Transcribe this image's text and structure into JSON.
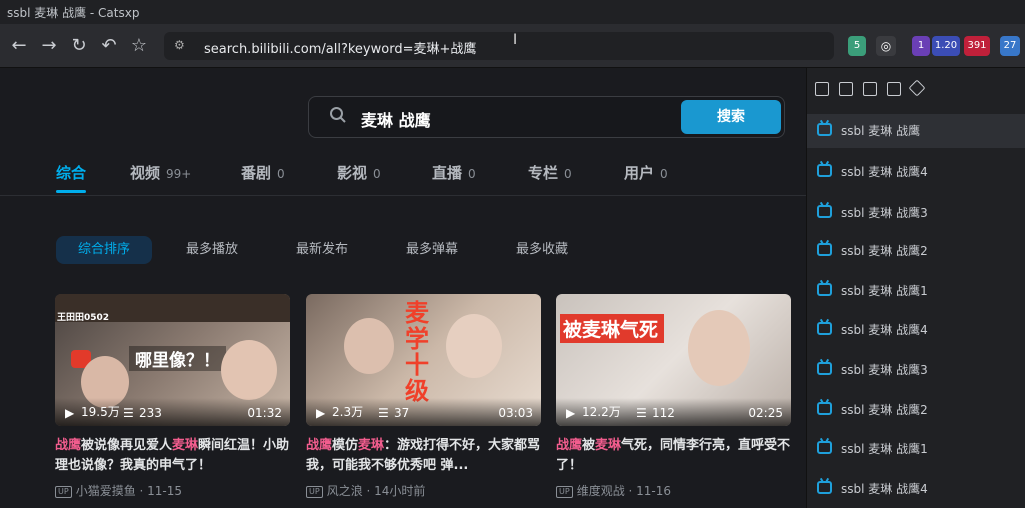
{
  "window": {
    "title": "ssbl 麦琳 战鹰 - Catsxp"
  },
  "toolbar": {
    "url": "search.bilibili.com/all?keyword=麦琳+战鹰",
    "ext_badges": [
      "5",
      "1",
      "1.20",
      "391",
      "27"
    ]
  },
  "search": {
    "query": "麦琳 战鹰",
    "button": "搜索"
  },
  "tabs": [
    {
      "label": "综合",
      "count": ""
    },
    {
      "label": "视频",
      "count": "99+"
    },
    {
      "label": "番剧",
      "count": "0"
    },
    {
      "label": "影视",
      "count": "0"
    },
    {
      "label": "直播",
      "count": "0"
    },
    {
      "label": "专栏",
      "count": "0"
    },
    {
      "label": "用户",
      "count": "0"
    }
  ],
  "sort": [
    "综合排序",
    "最多播放",
    "最新发布",
    "最多弹幕",
    "最多收藏"
  ],
  "cards": [
    {
      "thumb_text": "哪里像？！",
      "overlay": "王田田0502",
      "views": "19.5万",
      "danmaku": "233",
      "duration": "01:32",
      "title_hl1": "战鹰",
      "title_mid": "被说像再见爱人",
      "title_hl2": "麦琳",
      "title_rest": "瞬间红温！小助理也说像？我真的申气了！",
      "author": "小猫爱摸鱼",
      "date": "11-15"
    },
    {
      "thumb_text": "麦学十级",
      "overlay": "",
      "views": "2.3万",
      "danmaku": "37",
      "duration": "03:03",
      "title_hl1": "战鹰",
      "title_mid": "模仿",
      "title_hl2": "麦琳",
      "title_rest": "：游戏打得不好，大家都骂我，可能我不够优秀吧 弹...",
      "author": "风之浪",
      "date": "14小时前"
    },
    {
      "thumb_text": "被麦琳气死",
      "overlay": "",
      "views": "12.2万",
      "danmaku": "112",
      "duration": "02:25",
      "title_hl1": "战鹰",
      "title_mid": "被",
      "title_hl2": "麦琳",
      "title_rest": "气死，同情李行亮，直呼受不了！",
      "author": "维度观战",
      "date": "11-16"
    }
  ],
  "sidebar": {
    "items": [
      "ssbl 麦琳 战鹰",
      "ssbl 麦琳 战鹰4",
      "ssbl 麦琳 战鹰3",
      "ssbl 麦琳 战鹰2",
      "ssbl 麦琳 战鹰1",
      "ssbl 麦琳 战鹰4",
      "ssbl 麦琳 战鹰3",
      "ssbl 麦琳 战鹰2",
      "ssbl 麦琳 战鹰1",
      "ssbl 麦琳 战鹰4"
    ]
  }
}
